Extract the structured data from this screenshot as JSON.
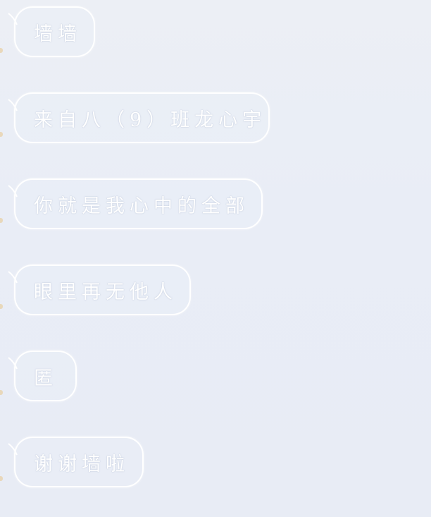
{
  "conversation": {
    "messages": [
      {
        "text": "墙墙"
      },
      {
        "text": "来自八（9）班龙心宇"
      },
      {
        "text": "你就是我心中的全部"
      },
      {
        "text": "眼里再无他人"
      },
      {
        "text": "匿"
      },
      {
        "text": "谢谢墙啦"
      }
    ]
  },
  "colors": {
    "background": "#eaeef6",
    "bubble_border": "#ffffff",
    "text": "#ffffff",
    "edge_mark": "#e8c78a"
  }
}
